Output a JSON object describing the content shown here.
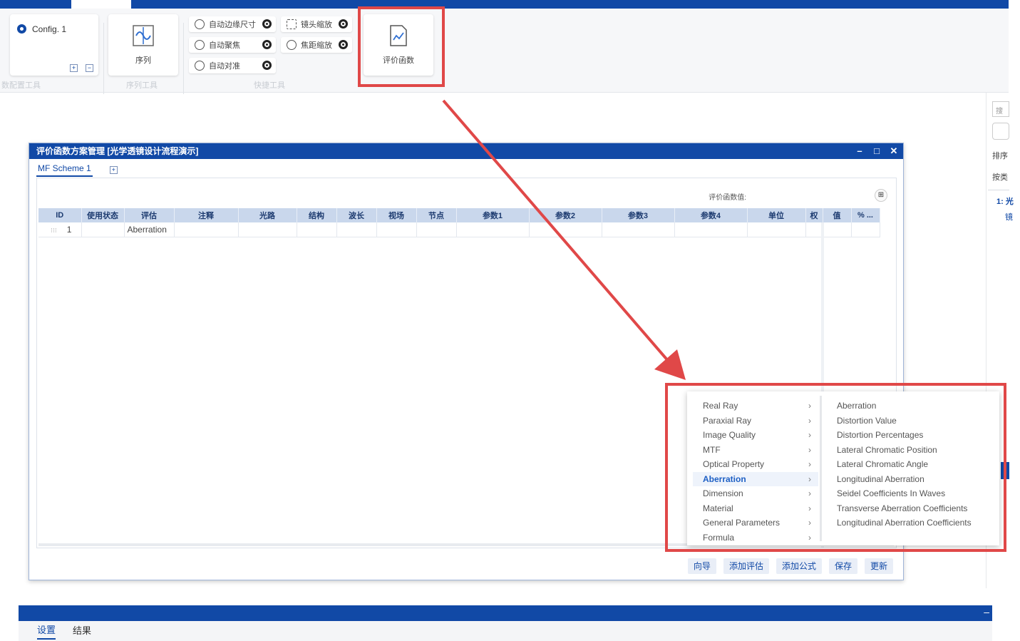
{
  "ribbon": {
    "config_label": "Config. 1",
    "sequence_label": "序列",
    "tools": {
      "auto_edge": "自动边缘尺寸",
      "auto_focus": "自动聚焦",
      "auto_align": "自动对准",
      "lens_zoom": "镜头缩放",
      "focus_zoom": "焦距缩放"
    },
    "merit_button": "评价函数",
    "groups": {
      "config": "数配置工具",
      "sequence": "序列工具",
      "quick": "快捷工具"
    }
  },
  "right_panel": {
    "items": [
      "搜索",
      "排序",
      "按类",
      "1: 光",
      "镜"
    ]
  },
  "dialog": {
    "title": "评价函数方案管理 [光学透镜设计流程演示]",
    "tab": "MF Scheme 1",
    "mf_value_label": "评价函数值:",
    "columns": [
      "ID",
      "使用状态",
      "评估",
      "注释",
      "光路",
      "结构",
      "波长",
      "视场",
      "节点",
      "参数1",
      "参数2",
      "参数3",
      "参数4",
      "单位",
      "权",
      "值",
      "% ..."
    ],
    "rows": [
      {
        "id": "1",
        "eval": "Aberration"
      }
    ],
    "buttons": [
      "向导",
      "添加评估",
      "添加公式",
      "保存",
      "更新"
    ]
  },
  "context_menu": {
    "categories": [
      {
        "label": "Real Ray",
        "active": false
      },
      {
        "label": "Paraxial Ray",
        "active": false
      },
      {
        "label": "Image Quality",
        "active": false
      },
      {
        "label": "MTF",
        "active": false
      },
      {
        "label": "Optical Property",
        "active": false
      },
      {
        "label": "Aberration",
        "active": true
      },
      {
        "label": "Dimension",
        "active": false
      },
      {
        "label": "Material",
        "active": false
      },
      {
        "label": "General Parameters",
        "active": false
      },
      {
        "label": "Formula",
        "active": false
      }
    ],
    "sub_items": [
      "Aberration",
      "Distortion Value",
      "Distortion Percentages",
      "Lateral Chromatic Position",
      "Lateral Chromatic Angle",
      "Longitudinal Aberration",
      "Seidel Coefficients In Waves",
      "Transverse Aberration Coefficients",
      "Longitudinal Aberration Coefficients"
    ]
  },
  "bottom": {
    "tabs": [
      "设置",
      "结果"
    ]
  },
  "colors": {
    "primary": "#1149a6",
    "annotation": "#e04848",
    "header_fill": "#c9d7ec"
  }
}
